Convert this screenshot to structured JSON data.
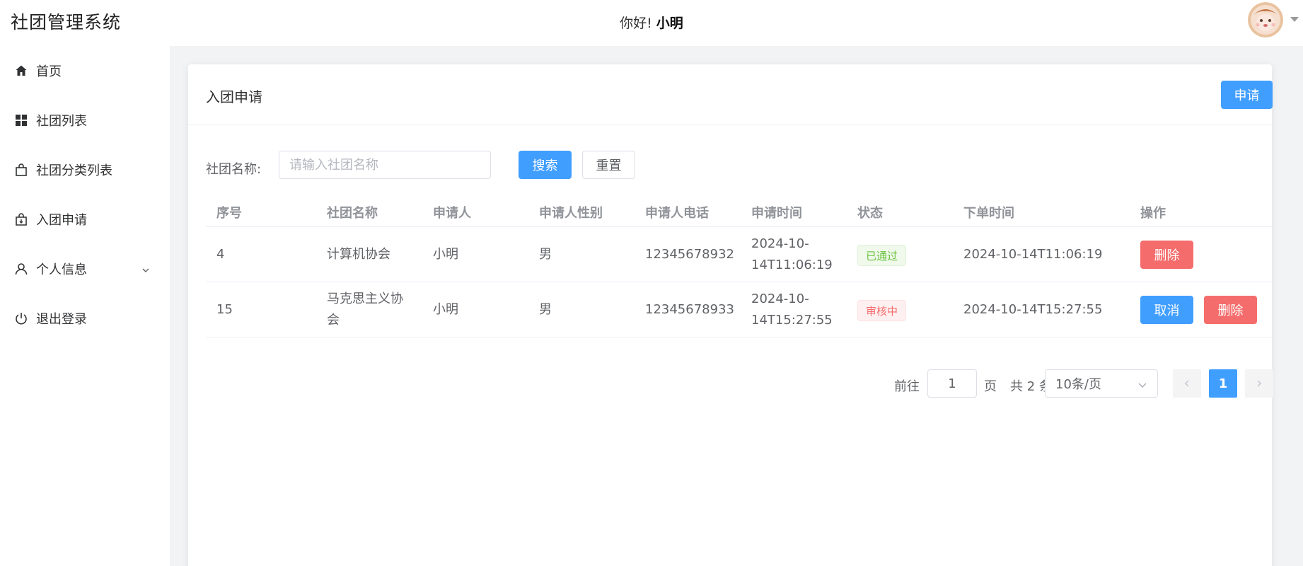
{
  "header": {
    "app_title": "社团管理系统",
    "greeting": "你好!",
    "username": "小明"
  },
  "sidebar": {
    "items": [
      {
        "label": "首页",
        "icon": "home-icon"
      },
      {
        "label": "社团列表",
        "icon": "grid-icon"
      },
      {
        "label": "社团分类列表",
        "icon": "bag-icon"
      },
      {
        "label": "入团申请",
        "icon": "bag-arrow-icon"
      },
      {
        "label": "个人信息",
        "icon": "user-icon",
        "expandable": true
      },
      {
        "label": "退出登录",
        "icon": "power-icon"
      }
    ]
  },
  "main": {
    "card_title": "入团申请",
    "apply_label": "申请",
    "search": {
      "label": "社团名称:",
      "placeholder": "请输入社团名称",
      "value": "",
      "search_label": "搜索",
      "reset_label": "重置"
    },
    "table": {
      "columns": [
        "序号",
        "社团名称",
        "申请人",
        "申请人性别",
        "申请人电话",
        "申请时间",
        "状态",
        "下单时间",
        "操作"
      ],
      "rows": [
        {
          "id": "4",
          "club_name_1": "计算机协会",
          "club_name_2": "",
          "applicant": "小明",
          "gender": "男",
          "phone": "12345678932",
          "apply_time_1": "2024-10-",
          "apply_time_2": "14T11:06:19",
          "status": "已通过",
          "order_time": "2024-10-14T11:06:19",
          "actions": [
            "删除"
          ]
        },
        {
          "id": "15",
          "club_name_1": "马克思主义协",
          "club_name_2": "会",
          "applicant": "小明",
          "gender": "男",
          "phone": "12345678933",
          "apply_time_1": "2024-10-",
          "apply_time_2": "14T15:27:55",
          "status": "审核中",
          "order_time": "2024-10-14T15:27:55",
          "actions": [
            "取消",
            "删除"
          ]
        }
      ]
    },
    "pagination": {
      "goto_label": "前往",
      "goto_value": "1",
      "page_label": "页",
      "total_label": "共 2 条",
      "page_size": "10条/页",
      "current_page": "1"
    }
  },
  "colors": {
    "primary": "#409eff",
    "danger": "#f56c6c",
    "success": "#67c23a",
    "main_bg": "#f2f3f5"
  }
}
